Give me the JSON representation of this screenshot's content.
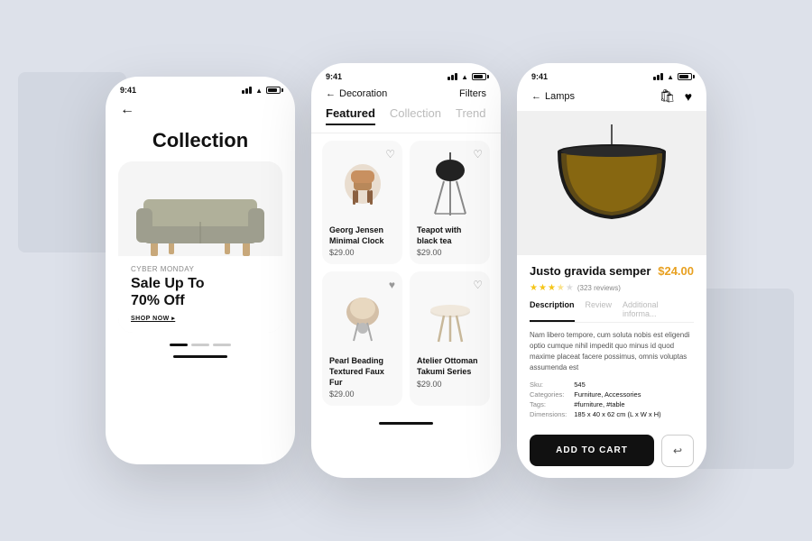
{
  "background": {
    "color": "#dde1ea"
  },
  "phone1": {
    "status_time": "9:41",
    "title": "Collection",
    "hero": {
      "label": "Cyber Monday",
      "sale_text": "Sale Up To\n70% Off",
      "cta": "SHOP NOW ▸"
    },
    "nav_back": "←"
  },
  "phone2": {
    "status_time": "9:41",
    "breadcrumb": "Decoration",
    "filters": "Filters",
    "tabs": [
      "Featured",
      "Collection",
      "Trend"
    ],
    "products": [
      {
        "name": "Georg Jensen Minimal Clock",
        "price": "$29.00"
      },
      {
        "name": "Teapot with black tea",
        "price": "$29.00"
      },
      {
        "name": "Pearl Beading Textured Faux Fur",
        "price": "$29.00"
      },
      {
        "name": "Atelier Ottoman Takumi Series",
        "price": "$29.00"
      }
    ]
  },
  "phone3": {
    "status_time": "9:41",
    "breadcrumb": "Lamps",
    "product": {
      "title": "Justo gravida semper",
      "price": "$24.00",
      "rating": 3.5,
      "review_count": "323 reviews",
      "description": "Nam libero tempore, cum soluta nobis est eligendi optio cumque nihil impedit quo minus id quod maxime placeat facere possimus, omnis voluptas assumenda est",
      "sku": "545",
      "categories": "Furniture, Accessories",
      "tags": "#furniture, #table",
      "dimensions": "185 x 40 x 62 cm (L x W x H)"
    },
    "tabs": [
      "Description",
      "Review",
      "Additional informa..."
    ],
    "add_to_cart": "ADD TO CART",
    "meta_labels": {
      "sku": "Sku:",
      "categories": "Categories:",
      "tags": "Tags:",
      "dimensions": "Dimensions:"
    }
  }
}
